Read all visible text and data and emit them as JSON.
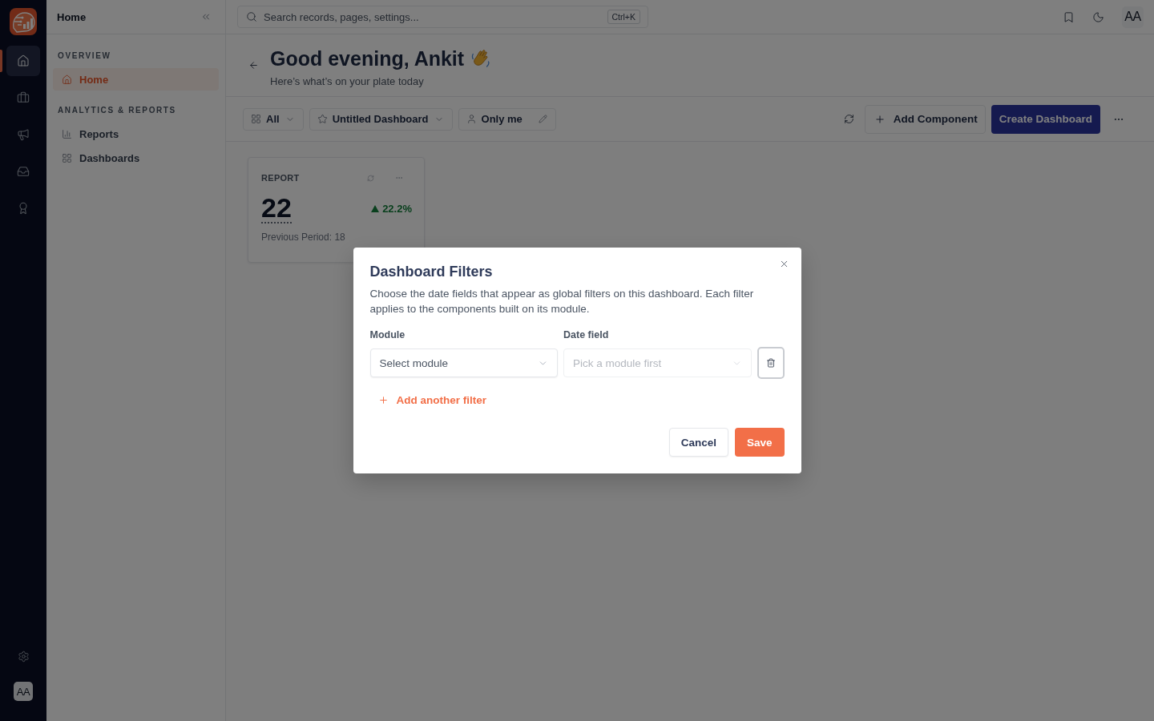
{
  "rail": {
    "items": [
      {
        "kind": "home",
        "selected": true
      },
      {
        "kind": "briefcase",
        "selected": false
      },
      {
        "kind": "megaphone",
        "selected": false
      },
      {
        "kind": "inbox",
        "selected": false
      },
      {
        "kind": "award",
        "selected": false
      }
    ],
    "avatar": "AA"
  },
  "sidebar": {
    "title": "Home",
    "sections": [
      {
        "label": "OVERVIEW",
        "items": [
          {
            "kind": "home",
            "label": "Home",
            "selected": true
          }
        ]
      },
      {
        "label": "ANALYTICS & REPORTS",
        "items": [
          {
            "kind": "reports",
            "label": "Reports",
            "selected": false
          },
          {
            "kind": "dashboards",
            "label": "Dashboards",
            "selected": false
          }
        ]
      }
    ]
  },
  "topbar": {
    "search": {
      "placeholder": "Search records, pages, settings...",
      "shortcut": "Ctrl+K"
    },
    "avatar": "AA"
  },
  "header": {
    "title": "Good evening, Ankit",
    "subtitle": "Here’s what’s on your plate today"
  },
  "toolbar": {
    "filters": [
      {
        "kind": "view",
        "label": "All"
      },
      {
        "kind": "dashboard",
        "label": "Untitled Dashboard"
      },
      {
        "kind": "owner",
        "label": "Only me"
      }
    ],
    "add_button": "Add Component",
    "create_button": "Create Dashboard"
  },
  "cards": [
    {
      "label": "REPORT",
      "value": "22",
      "rising": true,
      "change": "22.2%",
      "previous": "Previous Period: 18"
    }
  ],
  "dialog": {
    "title": "Dashboard Filters",
    "description": "Choose the date fields that appear as global filters on this dashboard. Each filter applies to the components built on its module.",
    "columns": [
      "Module",
      "Date field"
    ],
    "rows": [
      {
        "module": {
          "placeholder": "Select module",
          "disabled": false
        },
        "date_field": {
          "placeholder": "Pick a module first",
          "disabled": true
        }
      }
    ],
    "add_filter": "Add another filter",
    "cancel": "Cancel",
    "save": "Save"
  }
}
